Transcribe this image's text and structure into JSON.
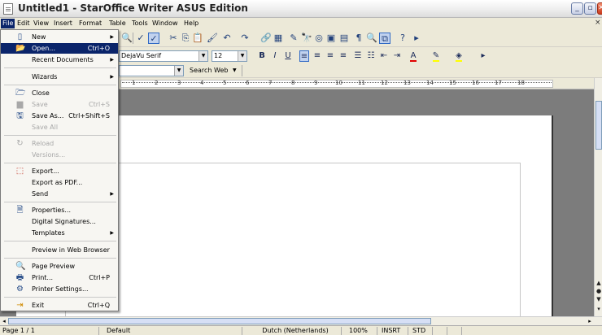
{
  "window": {
    "title": "Untitled1 - StarOffice Writer ASUS Edition",
    "min_label": "_",
    "max_label": "▫",
    "close_label": "✕",
    "doc_close": "×"
  },
  "menubar": {
    "items": [
      "File",
      "Edit",
      "View",
      "Insert",
      "Format",
      "Table",
      "Tools",
      "Window",
      "Help"
    ]
  },
  "formatting": {
    "paragraph_style": "",
    "font_name": "DejaVu Serif",
    "font_size": "12"
  },
  "navigation": {
    "search_label": "Search Web"
  },
  "ruler": {
    "labels": [
      "1",
      "2",
      "3",
      "4",
      "5",
      "6",
      "7",
      "8",
      "9",
      "10",
      "11",
      "12",
      "13",
      "14",
      "15",
      "16",
      "17",
      "18"
    ]
  },
  "file_menu": {
    "items": [
      {
        "label": "New",
        "shortcut": "",
        "submenu": true,
        "icon": "new-document-icon",
        "disabled": false
      },
      {
        "label": "Open...",
        "shortcut": "Ctrl+O",
        "submenu": false,
        "icon": "open-folder-icon",
        "disabled": false,
        "highlight": true
      },
      {
        "label": "Recent Documents",
        "shortcut": "",
        "submenu": true,
        "icon": "",
        "disabled": false
      },
      {
        "label": "Wizards",
        "shortcut": "",
        "submenu": true,
        "icon": "",
        "disabled": false
      },
      {
        "label": "Close",
        "shortcut": "",
        "submenu": false,
        "icon": "close-document-icon",
        "disabled": false
      },
      {
        "label": "Save",
        "shortcut": "Ctrl+S",
        "submenu": false,
        "icon": "save-icon",
        "disabled": true
      },
      {
        "label": "Save As...",
        "shortcut": "Ctrl+Shift+S",
        "submenu": false,
        "icon": "save-as-icon",
        "disabled": false
      },
      {
        "label": "Save All",
        "shortcut": "",
        "submenu": false,
        "icon": "",
        "disabled": true
      },
      {
        "label": "Reload",
        "shortcut": "",
        "submenu": false,
        "icon": "reload-icon",
        "disabled": true
      },
      {
        "label": "Versions...",
        "shortcut": "",
        "submenu": false,
        "icon": "",
        "disabled": true
      },
      {
        "label": "Export...",
        "shortcut": "",
        "submenu": false,
        "icon": "export-icon",
        "disabled": false
      },
      {
        "label": "Export as PDF...",
        "shortcut": "",
        "submenu": false,
        "icon": "",
        "disabled": false
      },
      {
        "label": "Send",
        "shortcut": "",
        "submenu": true,
        "icon": "",
        "disabled": false
      },
      {
        "label": "Properties...",
        "shortcut": "",
        "submenu": false,
        "icon": "properties-icon",
        "disabled": false
      },
      {
        "label": "Digital Signatures...",
        "shortcut": "",
        "submenu": false,
        "icon": "",
        "disabled": false
      },
      {
        "label": "Templates",
        "shortcut": "",
        "submenu": true,
        "icon": "",
        "disabled": false
      },
      {
        "label": "Preview in Web Browser",
        "shortcut": "",
        "submenu": false,
        "icon": "",
        "disabled": false
      },
      {
        "label": "Page Preview",
        "shortcut": "",
        "submenu": false,
        "icon": "page-preview-icon",
        "disabled": false
      },
      {
        "label": "Print...",
        "shortcut": "Ctrl+P",
        "submenu": false,
        "icon": "print-icon",
        "disabled": false
      },
      {
        "label": "Printer Settings...",
        "shortcut": "",
        "submenu": false,
        "icon": "printer-settings-icon",
        "disabled": false
      },
      {
        "label": "Exit",
        "shortcut": "Ctrl+Q",
        "submenu": false,
        "icon": "exit-icon",
        "disabled": false
      }
    ]
  },
  "statusbar": {
    "page": "Page 1 / 1",
    "style": "Default",
    "language": "Dutch (Netherlands)",
    "zoom": "100%",
    "insert_mode": "INSRT",
    "selection_mode": "STD"
  },
  "colors": {
    "menu_highlight": "#0a246a",
    "chrome": "#ece9d8",
    "doc_background": "#7c7c7c"
  }
}
